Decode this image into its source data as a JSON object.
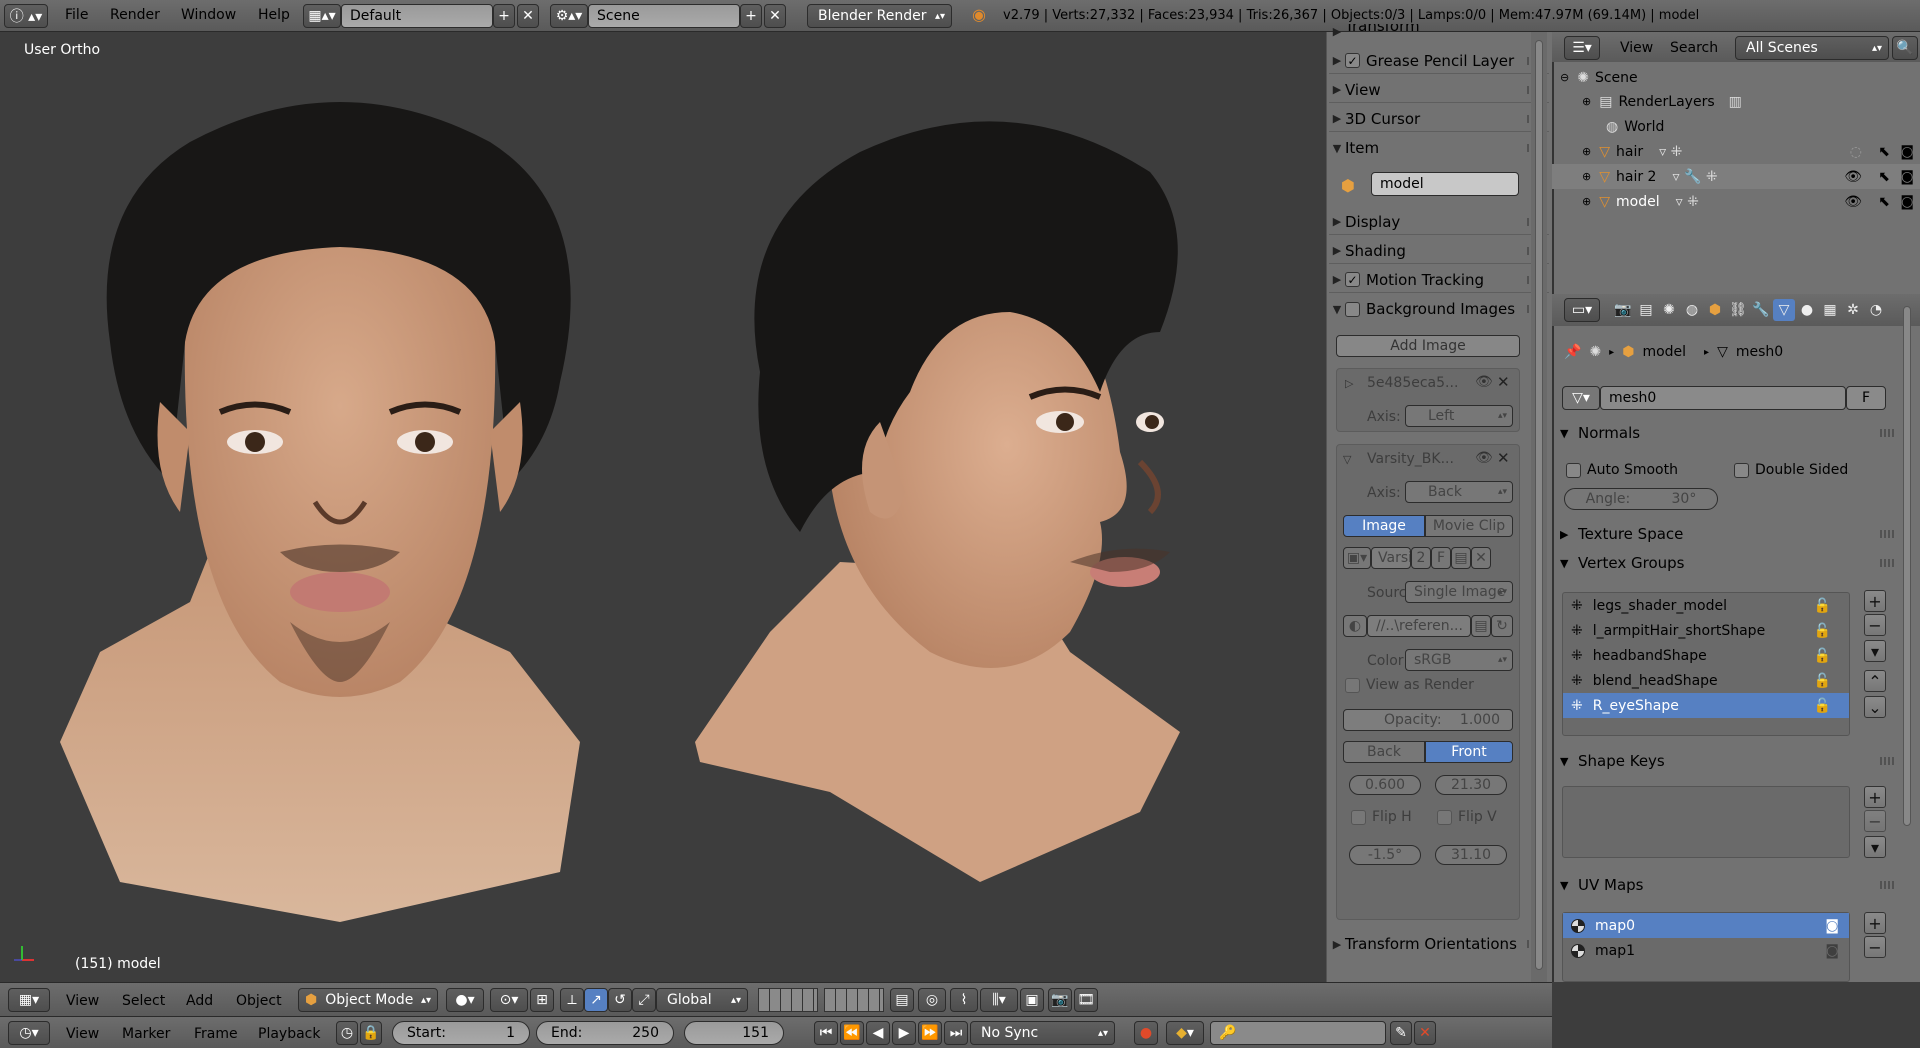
{
  "topbar": {
    "menus": [
      "File",
      "Render",
      "Window",
      "Help"
    ],
    "layout": "Default",
    "scene": "Scene",
    "engine": "Blender Render",
    "stats": "v2.79 | Verts:27,332 | Faces:23,934 | Tris:26,367 | Objects:0/3 | Lamps:0/0 | Mem:47.97M (69.14M) | model"
  },
  "viewport": {
    "view_label": "User Ortho",
    "object_label": "(151) model"
  },
  "npanel": {
    "sections": {
      "transform": "Transform",
      "grease_pencil": "Grease Pencil Layer",
      "view": "View",
      "cursor": "3D Cursor",
      "item": "Item",
      "display": "Display",
      "shading": "Shading",
      "motion_tracking": "Motion Tracking",
      "background_images": "Background Images",
      "transform_orientations": "Transform Orientations"
    },
    "item_name": "model",
    "add_image": "Add Image",
    "bg1": {
      "name": "5e485eca5...",
      "axis_label": "Axis:",
      "axis": "Left"
    },
    "bg2": {
      "name": "Varsity_BK...",
      "axis_label": "Axis:",
      "axis": "Back",
      "tab_image": "Image",
      "tab_clip": "Movie Clip",
      "img_name": "Varsi",
      "users": "2",
      "fake": "F",
      "source_label": "Source",
      "source": "Single Image",
      "path": "//..\\referen...",
      "color_label": "Color",
      "color": "sRGB",
      "view_as_render": "View as Render",
      "opacity": "Opacity:",
      "opacity_val": "1.000",
      "back": "Back",
      "front": "Front",
      "size": "0.600",
      "offx": "21.30",
      "flip_h": "Flip H",
      "flip_v": "Flip V",
      "rot": "-1.5°",
      "offy": "31.10"
    }
  },
  "outliner": {
    "header": {
      "view": "View",
      "search": "Search",
      "filter": "All Scenes"
    },
    "rows": [
      {
        "label": "Scene",
        "indent": 0
      },
      {
        "label": "RenderLayers",
        "indent": 1
      },
      {
        "label": "World",
        "indent": 1
      },
      {
        "label": "hair",
        "indent": 1
      },
      {
        "label": "hair 2",
        "indent": 1
      },
      {
        "label": "model",
        "indent": 1
      }
    ]
  },
  "properties": {
    "breadcrumb": {
      "object": "model",
      "mesh": "mesh0"
    },
    "mesh_name": "mesh0",
    "fake": "F",
    "normals": {
      "title": "Normals",
      "auto_smooth": "Auto Smooth",
      "double_sided": "Double Sided",
      "angle_label": "Angle:",
      "angle": "30°"
    },
    "texture_space": "Texture Space",
    "vertex_groups": {
      "title": "Vertex Groups",
      "items": [
        "legs_shader_model",
        "l_armpitHair_shortShape",
        "headbandShape",
        "blend_headShape",
        "R_eyeShape"
      ]
    },
    "shape_keys": "Shape Keys",
    "uv_maps": {
      "title": "UV Maps",
      "items": [
        "map0",
        "map1"
      ]
    }
  },
  "toolbar3d": {
    "menus": [
      "View",
      "Select",
      "Add",
      "Object"
    ],
    "mode": "Object Mode",
    "orientation": "Global"
  },
  "timeline": {
    "menus": [
      "View",
      "Marker",
      "Frame",
      "Playback"
    ],
    "start": "Start:",
    "start_val": "1",
    "end": "End:",
    "end_val": "250",
    "current": "151",
    "sync": "No Sync"
  }
}
